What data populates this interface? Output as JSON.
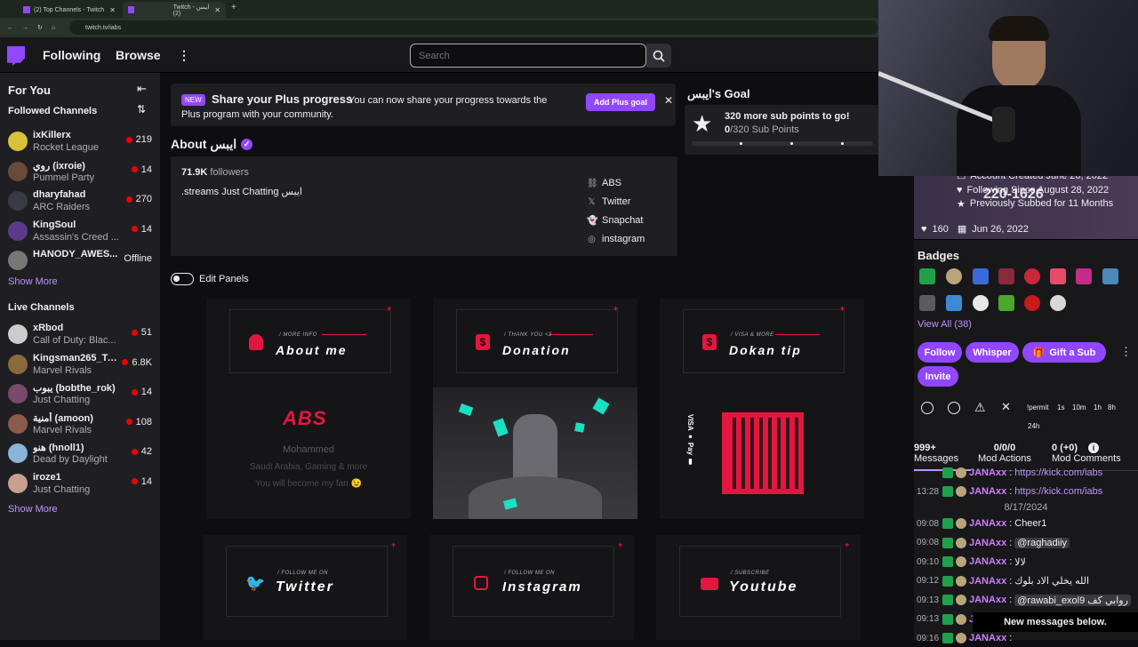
{
  "browser": {
    "tabs": [
      {
        "title": "(2) Top Channels - Twitch"
      },
      {
        "title": "Twitch - ايبس (2)"
      }
    ],
    "url": "twitch.tv/iabs"
  },
  "topnav": {
    "following": "Following",
    "browse": "Browse",
    "search_placeholder": "Search"
  },
  "sidebar": {
    "for_you": "For You",
    "followed_header": "Followed Channels",
    "followed": [
      {
        "name": "ixKillerx",
        "game": "Rocket League",
        "viewers": "219",
        "color": "#d8c23a"
      },
      {
        "name": "روي (ixroie)",
        "game": "Pummel Party",
        "viewers": "14",
        "color": "#6b4a3a"
      },
      {
        "name": "dharyfahad",
        "game": "ARC Raiders",
        "viewers": "270",
        "color": "#3a3a44"
      },
      {
        "name": "KingSoul",
        "game": "Assassin's Creed ...",
        "viewers": "14",
        "color": "#5a3a8a"
      },
      {
        "name": "HANODY_AWES...",
        "game": "",
        "viewers": "Offline",
        "color": "#777777"
      }
    ],
    "show_more_1": "Show More",
    "live_header": "Live Channels",
    "live": [
      {
        "name": "xRbod",
        "game": "Call of Duty: Blac...",
        "viewers": "51",
        "color": "#cccccc"
      },
      {
        "name": "Kingsman265_Tw...",
        "game": "Marvel Rivals",
        "viewers": "6.8K",
        "color": "#8a6a3a"
      },
      {
        "name": "يبوب (bobthe_rok)",
        "game": "Just Chatting",
        "viewers": "14",
        "color": "#7a4a6a"
      },
      {
        "name": "أمنية (amoon)",
        "game": "Marvel Rivals",
        "viewers": "108",
        "color": "#8a5a4a"
      },
      {
        "name": "هنو (hnoll1)",
        "game": "Dead by Daylight",
        "viewers": "42",
        "color": "#8ab4d8"
      },
      {
        "name": "iroze1",
        "game": "Just Chatting",
        "viewers": "14",
        "color": "#c8a090"
      }
    ],
    "show_more_2": "Show More"
  },
  "plus_banner": {
    "badge": "NEW",
    "title": "Share your Plus progress",
    "text1": "You can now share your progress towards the",
    "text2": "Plus program with your community.",
    "button": "Add Plus goal"
  },
  "goal": {
    "title": "ايبس's Goal",
    "headline": "320 more sub points to go!",
    "current": "0",
    "rest": "/320 Sub Points",
    "progress": 0
  },
  "about": {
    "title": "About ايبس",
    "followers_count": "71.9K",
    "followers_label": "followers",
    "bio": ".streams Just Chatting ايبس",
    "links": [
      "ABS",
      "Twitter",
      "Snapchat",
      "instagram"
    ]
  },
  "edit_panels": "Edit Panels",
  "panels": [
    {
      "sub": "/ MORE INFO",
      "title": "About me"
    },
    {
      "sub": "/ THANK YOU <3",
      "title": "Donation"
    },
    {
      "sub": "/ VISA & MORE",
      "title": "Dokan tip"
    },
    {
      "sub": "/ FOLLOW ME ON",
      "title": "Twitter"
    },
    {
      "sub": "/ FOLLOW ME ON",
      "title": "Instagram"
    },
    {
      "sub": "/ SUBSCRIBE",
      "title": "Youtube"
    }
  ],
  "about_panel": {
    "logo": "ABS",
    "name": "Mohammed",
    "line1": "Saudi Arabia, Gaming & more",
    "line2": "You will become my fan 😉"
  },
  "dokan_payments": "VISA ● Pay ▮",
  "user_card": {
    "stats1": "Account Created June 26, 2022",
    "stats2": "Following Since August 28, 2022",
    "stats3": "Previously Subbed for 11 Months",
    "overlay_number": "220-1626",
    "hearts": "160",
    "date": "Jun 26, 2022",
    "badges_title": "Badges",
    "view_all": "View All (38)",
    "follow": "Follow",
    "whisper": "Whisper",
    "gift": "Gift a Sub",
    "invite": "Invite",
    "timeouts": [
      "!permit",
      "1s",
      "10m",
      "1h",
      "8h",
      "24h"
    ],
    "messages_count": "999+",
    "messages_label": "Messages",
    "mod_actions_count": "0/0/0",
    "mod_actions_label": "Mod Actions",
    "mod_comments_count": "0 (+0)",
    "mod_comments_label": "Mod Comments"
  },
  "chat": {
    "top_line": {
      "user": "JANAxx",
      "msg": "https://kick.com/iabs"
    },
    "line2": {
      "ts": "13:28",
      "user": "JANAxx",
      "msg": "https://kick.com/iabs"
    },
    "date_sep": "8/17/2024",
    "lines": [
      {
        "ts": "09:08",
        "user": "JANAxx",
        "msg": "Cheer1"
      },
      {
        "ts": "09:08",
        "user": "JANAxx",
        "msg": "@raghadiiy"
      },
      {
        "ts": "09:10",
        "user": "JANAxx",
        "msg": "لالا"
      },
      {
        "ts": "09:12",
        "user": "JANAxx",
        "msg": "الله يخلي الاد بلوك"
      },
      {
        "ts": "09:13",
        "user": "JANAxx",
        "msg": "@rawabi_exol9 روابي كف"
      },
      {
        "ts": "09:13",
        "user": "JANAxx",
        "msg": ""
      },
      {
        "ts": "09:16",
        "user": "JANAxx",
        "msg": ""
      }
    ],
    "new_messages": "New messages below."
  },
  "colors": {
    "brand": "#9147ff",
    "accent_red": "#e3173e",
    "live_dot": "#eb0400"
  }
}
